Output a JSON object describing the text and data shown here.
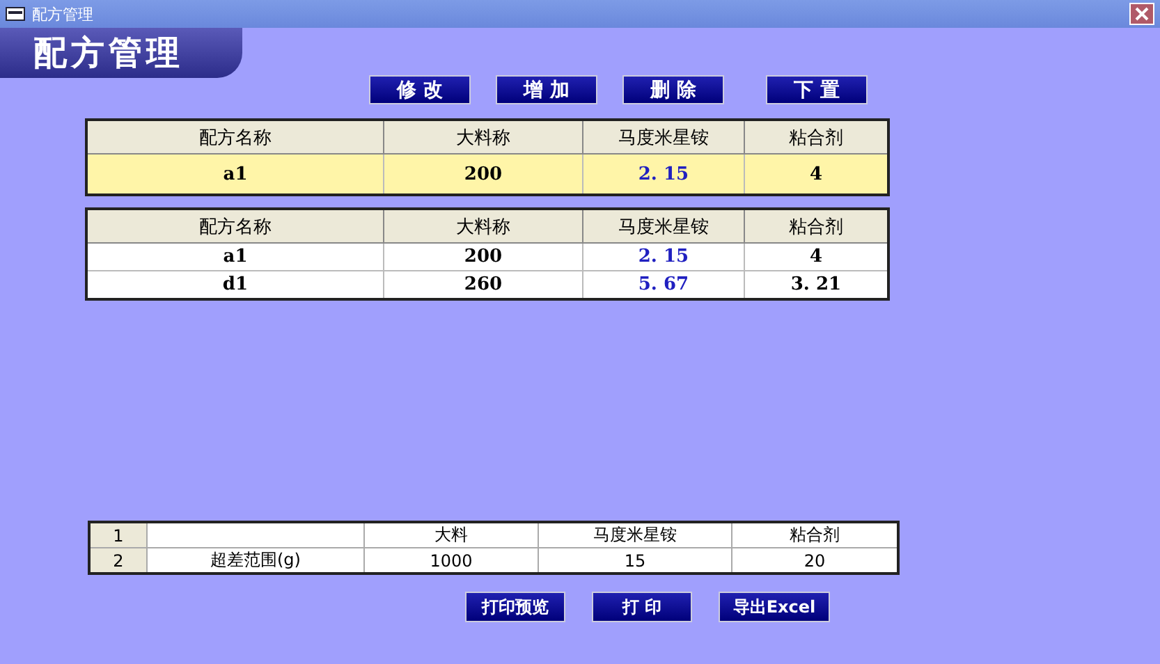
{
  "window": {
    "title": "配方管理"
  },
  "header": "配方管理",
  "toolbar": [
    "修 改",
    "增 加",
    "删 除",
    "下 置"
  ],
  "current_record": {
    "columns": [
      "配方名称",
      "大料称",
      "马度米星铵",
      "粘合剂"
    ],
    "row": [
      "a1",
      "200",
      "2. 15",
      "4"
    ]
  },
  "recipes": {
    "columns": [
      "配方名称",
      "大料称",
      "马度米星铵",
      "粘合剂"
    ],
    "rows": [
      [
        "a1",
        "200",
        "2. 15",
        "4"
      ],
      [
        "d1",
        "260",
        "5. 67",
        "3. 21"
      ]
    ]
  },
  "tolerance_grid": {
    "rows": [
      {
        "number": "1",
        "cells": [
          null,
          "大料",
          "马度米星铵",
          "粘合剂"
        ]
      },
      {
        "number": "2",
        "cells": [
          "超差范围(g)",
          "1000",
          "15",
          "20"
        ]
      }
    ]
  },
  "print_buttons": [
    "打印预览",
    "打 印",
    "导出Excel"
  ]
}
